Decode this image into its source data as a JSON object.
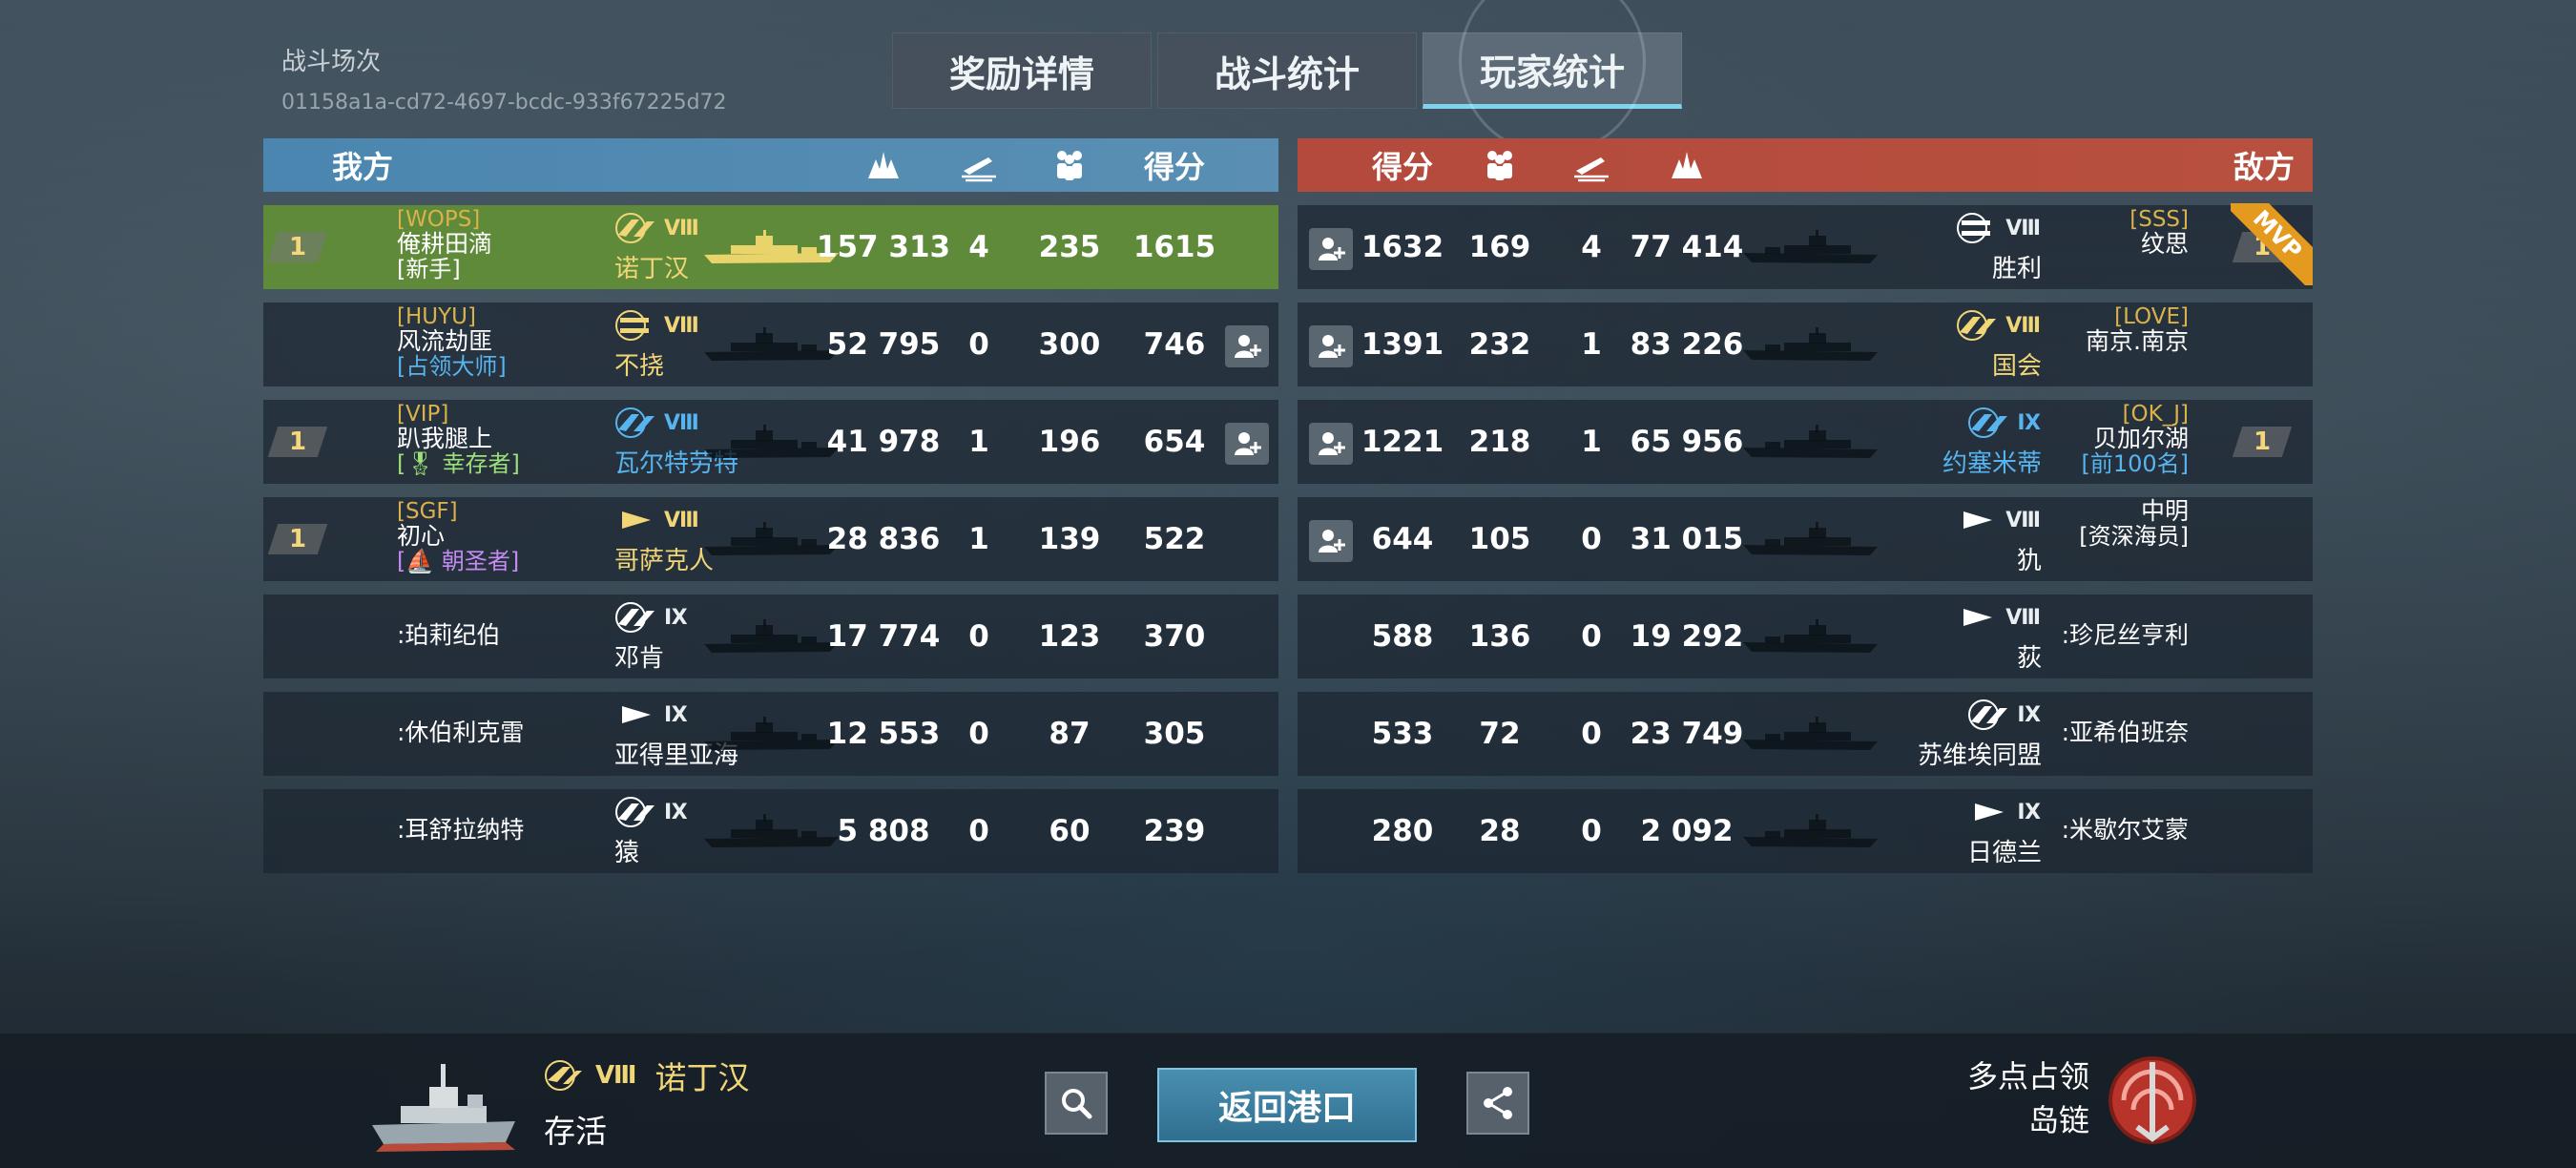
{
  "battle": {
    "label": "战斗场次",
    "id": "01158a1a-cd72-4697-bcdc-933f67225d72"
  },
  "tabs": [
    "奖励详情",
    "战斗统计",
    "玩家统计"
  ],
  "ours": {
    "title": "我方",
    "score_header": "得分",
    "rows": [
      {
        "rank": "1",
        "clan": "[WOPS]",
        "name": "俺耕田滴",
        "tag": "[新手]",
        "tag_color": "white",
        "class": "cruiser",
        "tier": "Ⅷ",
        "tier_color": "gold",
        "ship": "诺丁汉",
        "ship_color": "gold",
        "damage": "157 313",
        "kills": "4",
        "capture": "235",
        "score": "1615",
        "add": false,
        "highlight": true
      },
      {
        "rank": "",
        "clan": "[HUYU]",
        "name": "风流劫匪",
        "tag": "[占领大师]",
        "tag_color": "blue",
        "class": "battleship",
        "tier": "Ⅷ",
        "tier_color": "gold",
        "ship": "不挠",
        "ship_color": "gold",
        "damage": "52 795",
        "kills": "0",
        "capture": "300",
        "score": "746",
        "add": true,
        "highlight": false
      },
      {
        "rank": "1",
        "clan": "[VIP]",
        "name": "趴我腿上",
        "tag": "[🎖 幸存者]",
        "tag_color": "green",
        "class": "cruiser",
        "tier": "Ⅷ",
        "tier_color": "blue",
        "ship": "瓦尔特劳特",
        "ship_color": "blue",
        "damage": "41 978",
        "kills": "1",
        "capture": "196",
        "score": "654",
        "add": true,
        "highlight": false
      },
      {
        "rank": "1",
        "clan": "[SGF]",
        "name": "初心",
        "tag": "[⛵ 朝圣者]",
        "tag_color": "purple",
        "class": "destroyer",
        "tier": "Ⅷ",
        "tier_color": "gold",
        "ship": "哥萨克人",
        "ship_color": "gold",
        "damage": "28 836",
        "kills": "1",
        "capture": "139",
        "score": "522",
        "add": false,
        "highlight": false
      },
      {
        "rank": "",
        "clan": "",
        "name": ":珀莉纪伯",
        "tag": "",
        "tag_color": "white",
        "class": "cruiser",
        "tier": "Ⅸ",
        "tier_color": "white",
        "ship": "邓肯",
        "ship_color": "white",
        "damage": "17 774",
        "kills": "0",
        "capture": "123",
        "score": "370",
        "add": false,
        "highlight": false
      },
      {
        "rank": "",
        "clan": "",
        "name": ":休伯利克雷",
        "tag": "",
        "tag_color": "white",
        "class": "destroyer",
        "tier": "Ⅸ",
        "tier_color": "white",
        "ship": "亚得里亚海",
        "ship_color": "white",
        "damage": "12 553",
        "kills": "0",
        "capture": "87",
        "score": "305",
        "add": false,
        "highlight": false
      },
      {
        "rank": "",
        "clan": "",
        "name": ":耳舒拉纳特",
        "tag": "",
        "tag_color": "white",
        "class": "cruiser",
        "tier": "Ⅸ",
        "tier_color": "white",
        "ship": "猿",
        "ship_color": "white",
        "damage": "5 808",
        "kills": "0",
        "capture": "60",
        "score": "239",
        "add": false,
        "highlight": false
      }
    ]
  },
  "enemy": {
    "title": "敌方",
    "score_header": "得分",
    "rows": [
      {
        "rank": "1",
        "clan": "[SSS]",
        "name": "纹思",
        "tag": "",
        "tag_color": "white",
        "class": "battleship",
        "tier": "Ⅷ",
        "tier_color": "white",
        "ship": "胜利",
        "ship_color": "white",
        "damage": "77 414",
        "kills": "4",
        "capture": "169",
        "score": "1632",
        "add": true,
        "mvp": "MVP"
      },
      {
        "rank": "",
        "clan": "[LOVE]",
        "name": "南京.南京",
        "tag": "",
        "tag_color": "white",
        "class": "cruiser",
        "tier": "Ⅷ",
        "tier_color": "gold",
        "ship": "国会",
        "ship_color": "gold",
        "damage": "83 226",
        "kills": "1",
        "capture": "232",
        "score": "1391",
        "add": true,
        "mvp": ""
      },
      {
        "rank": "1",
        "clan": "[OK_J]",
        "name": "贝加尔湖",
        "tag": "[前100名]",
        "tag_color": "blue",
        "class": "cruiser",
        "tier": "Ⅸ",
        "tier_color": "blue",
        "ship": "约塞米蒂",
        "ship_color": "blue",
        "damage": "65 956",
        "kills": "1",
        "capture": "218",
        "score": "1221",
        "add": true,
        "mvp": ""
      },
      {
        "rank": "",
        "clan": "",
        "name": "中明",
        "tag": "[资深海员]",
        "tag_color": "white",
        "class": "destroyer",
        "tier": "Ⅷ",
        "tier_color": "white",
        "ship": "犰",
        "ship_color": "white",
        "damage": "31 015",
        "kills": "0",
        "capture": "105",
        "score": "644",
        "add": true,
        "mvp": ""
      },
      {
        "rank": "",
        "clan": "",
        "name": ":珍尼丝亨利",
        "tag": "",
        "tag_color": "white",
        "class": "destroyer",
        "tier": "Ⅷ",
        "tier_color": "white",
        "ship": "荻",
        "ship_color": "white",
        "damage": "19 292",
        "kills": "0",
        "capture": "136",
        "score": "588",
        "add": false,
        "mvp": ""
      },
      {
        "rank": "",
        "clan": "",
        "name": ":亚希伯班奈",
        "tag": "",
        "tag_color": "white",
        "class": "cruiser",
        "tier": "Ⅸ",
        "tier_color": "white",
        "ship": "苏维埃同盟",
        "ship_color": "white",
        "damage": "23 749",
        "kills": "0",
        "capture": "72",
        "score": "533",
        "add": false,
        "mvp": ""
      },
      {
        "rank": "",
        "clan": "",
        "name": ":米歇尔艾蒙",
        "tag": "",
        "tag_color": "white",
        "class": "destroyer",
        "tier": "Ⅸ",
        "tier_color": "white",
        "ship": "日德兰",
        "ship_color": "white",
        "damage": "2 092",
        "kills": "0",
        "capture": "28",
        "score": "280",
        "add": false,
        "mvp": ""
      }
    ]
  },
  "bottom": {
    "tier": "Ⅷ",
    "ship": "诺丁汉",
    "status": "存活",
    "return_label": "返回港口",
    "mode": "多点占领",
    "map": "岛链"
  },
  "colors": {
    "ours_header": "#4a86b0",
    "enemy_header": "#b34a3d",
    "highlight_row": "#5e8a3a",
    "gold": "#f1d678",
    "blue": "#57b4ee",
    "mvp": "#e39a1f"
  }
}
